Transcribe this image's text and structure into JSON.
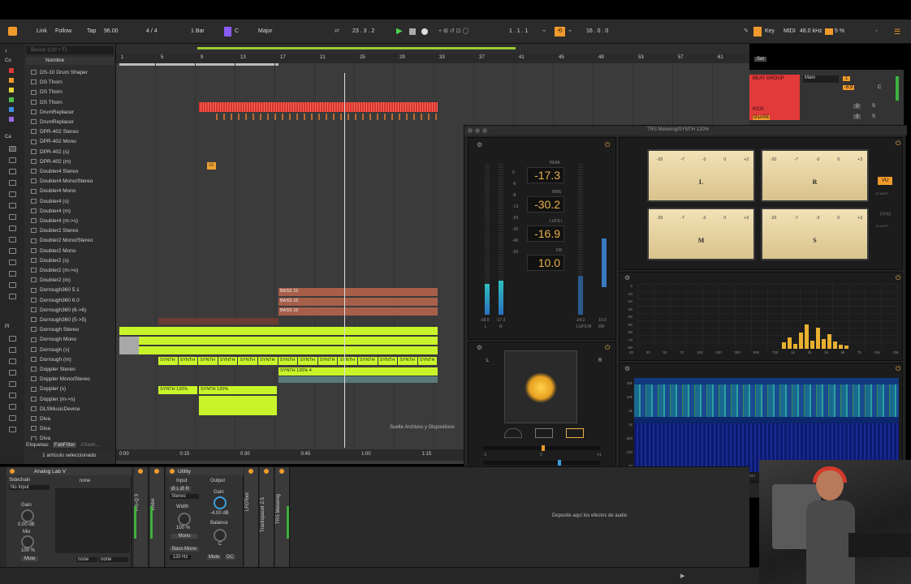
{
  "control_bar": {
    "link": "Link",
    "follow": "Follow",
    "tap": "Tap",
    "tempo": "96.00",
    "signature": "4 / 4",
    "quantize": "1 Bar",
    "key_root": "C",
    "key_scale": "Major",
    "position": "23 .  3 .  2",
    "loop_start": "1 .  1 .  1",
    "loop_length": "16 .  0 .  0",
    "key": "Key",
    "midi": "MIDI",
    "sample_rate": "48.0 kHz",
    "cpu": "5 %"
  },
  "browser": {
    "search_placeholder": "Buscar (Ctrl + F)",
    "left_labels": [
      "Co",
      "Ca",
      "Pl"
    ],
    "column_header": "Nombre",
    "items": [
      "DS-10 Drum Shaper",
      "DS Thorn",
      "DS Thorn",
      "DS Thorn",
      "DrumReplacer",
      "DrumReplacer",
      "DPR-402 Stereo",
      "DPR-402 Mono",
      "DPR-402 (s)",
      "DPR-402 (m)",
      "Doubler4 Stereo",
      "Doubler4 Mono/Stereo",
      "Doubler4 Mono",
      "Doubler4 (s)",
      "Doubler4 (m)",
      "Doubler4 (m->s)",
      "Doubler2 Stereo",
      "Doubler2 Mono/Stereo",
      "Doubler2 Mono",
      "Doubler2 (s)",
      "Doubler2 (m->s)",
      "Doubler2 (m)",
      "Dorrough360 5.1",
      "Dorrough360 6.0",
      "Dorrough360 (6->6)",
      "Dorrough360 (5->5)",
      "Dorrough Stereo",
      "Dorrough Mono",
      "Dorrough (s)",
      "Dorrough (m)",
      "Doppler Stereo",
      "Doppler Mono/Stereo",
      "Doppler (s)",
      "Doppler (m->s)",
      "DLSMusicDevice",
      "Diva",
      "Diva",
      "Diva"
    ],
    "tags_label": "Etiquetas:",
    "tag": "FabFilter",
    "add_label": "Añadir...",
    "selected": "1 artículo seleccionado"
  },
  "timeline": {
    "bars": [
      "1",
      "5",
      "9",
      "13",
      "17",
      "21",
      "25",
      "29",
      "33",
      "37",
      "41",
      "45",
      "49",
      "53",
      "57",
      "61"
    ],
    "times": [
      "0:00",
      "0:15",
      "0:30",
      "0:45",
      "1:00",
      "1:15"
    ],
    "drop_hint": "Suelte Archivos y Dispositivos"
  },
  "clips": {
    "small": "10",
    "bass": "BASS 15",
    "synth": "SYNTH",
    "synth120": "SYNTH 120%",
    "synth120_4": "SYNTH 120% 4"
  },
  "mixer": {
    "set": "Set",
    "output": "Main",
    "tracks": [
      {
        "name": "BEAT GROUP",
        "num": "1",
        "vol": "-6.9",
        "pan": "C"
      },
      {
        "name": "KICK",
        "num": "2",
        "s": "S"
      },
      {
        "name": "SNARE",
        "num": "3",
        "s": "S"
      }
    ]
  },
  "plugin": {
    "title": "TRS Metering/SYNTH 120%",
    "peak_label": "PEAK",
    "peak": "-17.3",
    "rms_label": "RMS",
    "rms": "-30.2",
    "lufs_label": "LUFS I",
    "lufs": "-16.9",
    "dr_label": "DR",
    "dr": "10.0",
    "left_meter_vals": [
      "-18.9",
      "-17.3"
    ],
    "lr": [
      "L",
      "R"
    ],
    "right_meter_vals": [
      "-24.2",
      "10.0"
    ],
    "right_meter_lbls": [
      "LUFS M",
      "DR"
    ],
    "meter_scale": [
      "0",
      "-6",
      "-8",
      "-13",
      "-20",
      "-30",
      "-40",
      "-50"
    ],
    "vu_meters": [
      "L",
      "R",
      "M",
      "S"
    ],
    "vu_scale": [
      "-20",
      "-10",
      "-7",
      "-5",
      "-3",
      "-1",
      "0",
      "+1",
      "+2",
      "+3"
    ],
    "vu_btn": "VU",
    "vu_sub": "-12 dBFS",
    "ppm_btn": "PPM",
    "ppm_sub": "-18 dBFS",
    "spec_y": [
      "0",
      "-10",
      "-20",
      "-30",
      "-40",
      "-50",
      "-60",
      "-70",
      "-80"
    ],
    "spec_x": [
      "20",
      "30",
      "50",
      "70",
      "100",
      "200",
      "300",
      "500",
      "700",
      "1k",
      "2k",
      "3k",
      "5k",
      "7k",
      "10k",
      "20k"
    ],
    "spectro_y": [
      "20k",
      "10k",
      "5k",
      "1k",
      "300",
      "100",
      "30"
    ],
    "spectro_x": [
      "42s",
      "40s",
      "38s",
      "36s",
      "34s",
      "32s",
      "30s",
      "28s",
      "26s",
      "24s"
    ],
    "vs_lr": [
      "L",
      "R"
    ],
    "corr_lbls": [
      "-1",
      "0",
      "+1"
    ],
    "bal_lbls": [
      "L",
      "C",
      "R"
    ]
  },
  "devices": {
    "analog_lab": "Analog Lab V",
    "sidechain": "Sidechain",
    "no_input": "No Input",
    "none": "none",
    "gain": "Gain",
    "gain_val": "0.00 dB",
    "mix": "Mix",
    "mix_val": "100 %",
    "mute": "Mute",
    "rack1": "Pro-Q 3",
    "rack2": "Wider",
    "utility": "Utility",
    "input": "Input",
    "phase": "Ø L   Ø R",
    "stereo": "Stereo",
    "width": "Width",
    "width_val": "100 %",
    "mono": "Mono",
    "bass_mono": "Bass Mono",
    "hz": "120 Hz",
    "output": "Output",
    "out_gain": "Gain",
    "out_gain_val": "-4.00 dB",
    "balance": "Balance",
    "balance_val": "C",
    "out_mute": "Mute",
    "dc": "DC",
    "rack3": "LFOTool",
    "rack4": "Trackspacer 2.5",
    "rack5": "TRS Metering",
    "drop_fx": "Deposite aquí los efectos de audio"
  },
  "colors": {
    "accent": "#f09a2b",
    "synth": "#c8f52a",
    "bass": "#a85f4a",
    "red_clip": "#d9342b"
  }
}
